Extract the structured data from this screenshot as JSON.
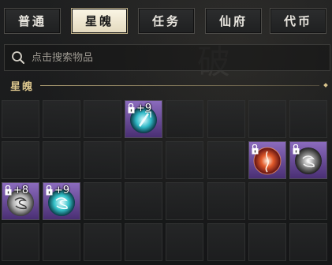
{
  "tabs": [
    {
      "label": "普通",
      "active": false
    },
    {
      "label": "星魄",
      "active": true
    },
    {
      "label": "任务",
      "active": false
    },
    {
      "label": "仙府",
      "active": false
    },
    {
      "label": "代币",
      "active": false
    }
  ],
  "search": {
    "placeholder": "点击搜索物品",
    "value": ""
  },
  "section": {
    "title": "星魄"
  },
  "items": [
    {
      "row": 0,
      "col": 3,
      "count": "+9",
      "kind": "cyan-sword-orb"
    },
    {
      "row": 1,
      "col": 6,
      "count": "",
      "kind": "red-orb"
    },
    {
      "row": 1,
      "col": 7,
      "count": "",
      "kind": "silver-orb"
    },
    {
      "row": 2,
      "col": 0,
      "count": "+8",
      "kind": "white-orb"
    },
    {
      "row": 2,
      "col": 1,
      "count": "+9",
      "kind": "cyan-orb"
    }
  ],
  "colors": {
    "accent": "#d9c48c",
    "active_tab": "#f4eedb",
    "background": "#1b1c1d"
  }
}
